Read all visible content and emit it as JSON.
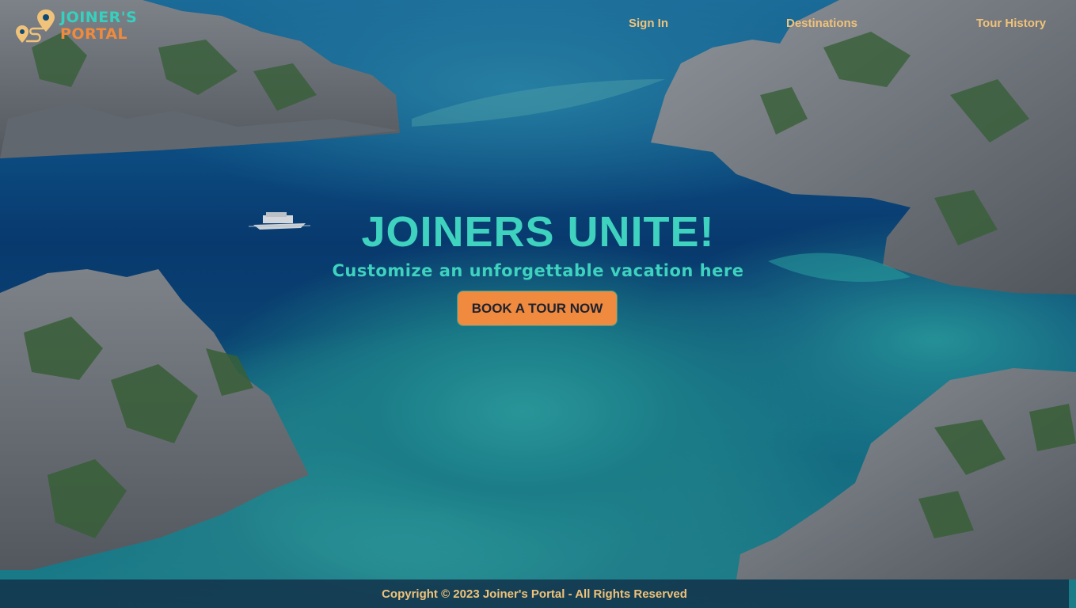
{
  "header": {
    "logo": {
      "line1": "JOINER'S",
      "line2": "PORTAL",
      "icon": "map-route-pin-icon"
    },
    "nav": {
      "sign_in": "Sign In",
      "destinations": "Destinations",
      "tour_history": "Tour History"
    }
  },
  "hero": {
    "title": "JOINERS UNITE!",
    "subtitle": "Customize an unforgettable vacation here",
    "cta_label": "BOOK A TOUR NOW"
  },
  "footer": {
    "copyright": "Copyright © 2023 Joiner's Portal - All Rights Reserved"
  },
  "colors": {
    "accent_teal": "#3ed2bf",
    "accent_orange": "#ef8a3e",
    "nav_gold": "#f0c27a"
  }
}
